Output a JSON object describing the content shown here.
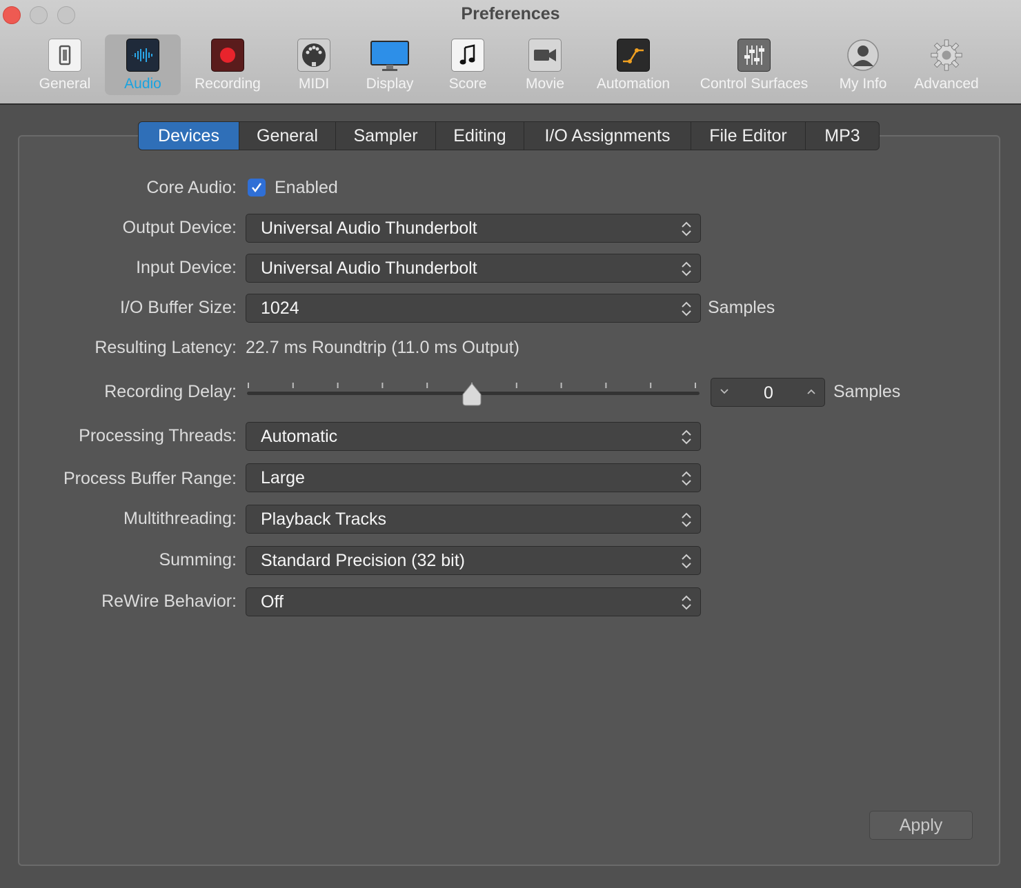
{
  "window": {
    "title": "Preferences"
  },
  "toolbar": {
    "items": [
      {
        "label": "General",
        "icon": "general-switch-icon"
      },
      {
        "label": "Audio",
        "icon": "audio-waveform-icon",
        "selected": true
      },
      {
        "label": "Recording",
        "icon": "record-icon"
      },
      {
        "label": "MIDI",
        "icon": "midi-connector-icon"
      },
      {
        "label": "Display",
        "icon": "display-monitor-icon"
      },
      {
        "label": "Score",
        "icon": "score-note-icon"
      },
      {
        "label": "Movie",
        "icon": "movie-camera-icon"
      },
      {
        "label": "Automation",
        "icon": "automation-curve-icon"
      },
      {
        "label": "Control Surfaces",
        "icon": "control-surfaces-faders-icon"
      },
      {
        "label": "My Info",
        "icon": "user-silhouette-icon"
      },
      {
        "label": "Advanced",
        "icon": "gear-icon"
      }
    ]
  },
  "tabs": [
    {
      "label": "Devices",
      "active": true
    },
    {
      "label": "General"
    },
    {
      "label": "Sampler"
    },
    {
      "label": "Editing"
    },
    {
      "label": "I/O Assignments"
    },
    {
      "label": "File Editor"
    },
    {
      "label": "MP3"
    }
  ],
  "devices": {
    "core_audio": {
      "label": "Core Audio:",
      "checkbox_label": "Enabled",
      "checked": true
    },
    "output_device": {
      "label": "Output Device:",
      "value": "Universal Audio Thunderbolt"
    },
    "input_device": {
      "label": "Input Device:",
      "value": "Universal Audio Thunderbolt"
    },
    "buffer_size": {
      "label": "I/O Buffer Size:",
      "value": "1024",
      "unit": "Samples"
    },
    "latency": {
      "label": "Resulting Latency:",
      "value": "22.7 ms Roundtrip (11.0 ms Output)"
    },
    "recording_delay": {
      "label": "Recording Delay:",
      "value": "0",
      "unit": "Samples",
      "slider_fraction": 0.5
    },
    "processing_threads": {
      "label": "Processing Threads:",
      "value": "Automatic"
    },
    "process_buffer_range": {
      "label": "Process Buffer Range:",
      "value": "Large"
    },
    "multithreading": {
      "label": "Multithreading:",
      "value": "Playback Tracks"
    },
    "summing": {
      "label": "Summing:",
      "value": "Standard Precision (32 bit)"
    },
    "rewire": {
      "label": "ReWire Behavior:",
      "value": "Off"
    }
  },
  "apply_label": "Apply",
  "colors": {
    "accent": "#2f6fb8",
    "selected_label": "#19a3e0",
    "record_red": "#e8242c",
    "automation_orange": "#f0a020"
  }
}
